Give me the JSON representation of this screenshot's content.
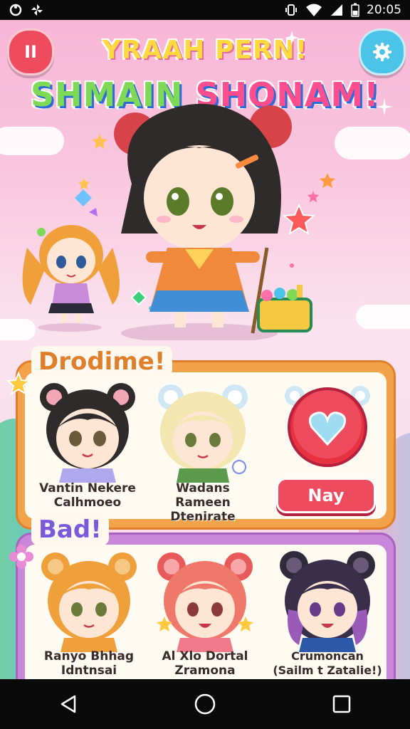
{
  "status_bar": {
    "time": "20:05"
  },
  "header": {
    "title_line1": "YRAAH PERN!",
    "title_line2_green": "SHMAIN ",
    "title_line2_pink": "SHONAM!"
  },
  "buttons": {
    "pause_label": "II",
    "big_action_label": "",
    "nay_label": "Nay"
  },
  "panel_top": {
    "tag": "Drodime!",
    "characters": [
      {
        "line1": "Vantin Nekere",
        "line2": "Calhmoeo"
      },
      {
        "line1": "Wadans Rameen",
        "line2": "Dtenirate"
      }
    ]
  },
  "panel_bottom": {
    "tag": "Bad!",
    "characters": [
      {
        "line1": "Ranyo Bhhag",
        "line2": "Idntnsai"
      },
      {
        "line1": "Al Xlo Dortal",
        "line2": "Zramona"
      },
      {
        "line1": "Crumoncan",
        "line2": "(Sailm t Zatalie!)"
      }
    ]
  },
  "colors": {
    "accent_red": "#ef4b5f",
    "accent_blue": "#4cc3e8",
    "panel_orange": "#f2a248",
    "panel_purple": "#c987d9"
  },
  "icons": {
    "pause": "pause-icon",
    "settings": "gear-icon",
    "heart": "heart-icon"
  }
}
